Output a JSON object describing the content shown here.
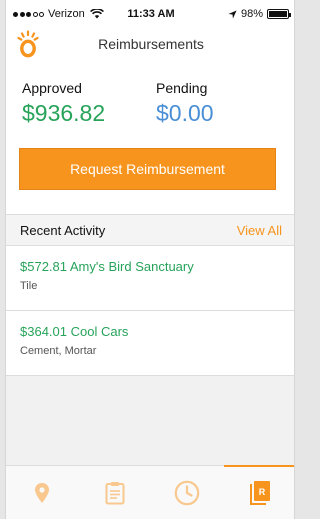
{
  "status_bar": {
    "carrier": "Verizon",
    "time": "11:33 AM",
    "battery": "98%",
    "battery_level": 0.98
  },
  "header": {
    "title": "Reimbursements"
  },
  "summary": {
    "approved_label": "Approved",
    "approved_value": "$936.82",
    "pending_label": "Pending",
    "pending_value": "$0.00",
    "request_button_label": "Request Reimbursement"
  },
  "activity": {
    "title": "Recent Activity",
    "view_all_label": "View All",
    "items": [
      {
        "title": "$572.81 Amy's Bird Sanctuary",
        "subtitle": "Tile"
      },
      {
        "title": "$364.01 Cool Cars",
        "subtitle": "Cement, Mortar"
      }
    ]
  },
  "tabs": [
    {
      "icon": "location-pin-icon",
      "active": false
    },
    {
      "icon": "clipboard-icon",
      "active": false
    },
    {
      "icon": "clock-icon",
      "active": false
    },
    {
      "icon": "reimbursement-docs-icon",
      "active": true,
      "badge": "R"
    }
  ],
  "colors": {
    "accent": "#f7941d",
    "approved": "#27a35a",
    "pending": "#4a8fd6",
    "tab_icon": "#f8c88f"
  }
}
